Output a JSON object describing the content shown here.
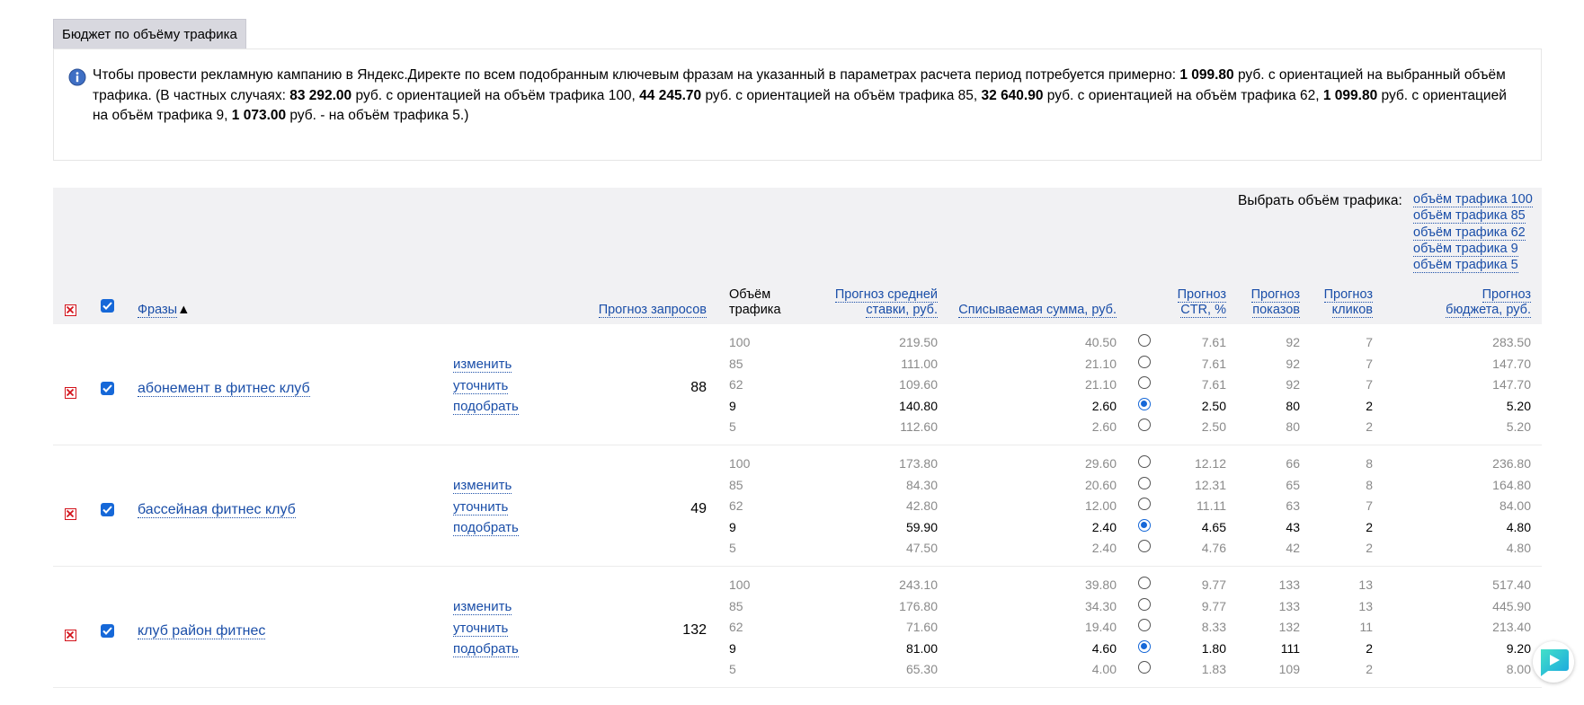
{
  "tab_title": "Бюджет по объёму трафика",
  "info": {
    "parts": [
      {
        "t": "Чтобы провести рекламную кампанию в Яндекс.Директе по всем подобранным ключевым фразам на указанный в параметрах расчета период потребуется примерно: ",
        "b": false
      },
      {
        "t": "1 099.80",
        "b": true
      },
      {
        "t": " руб. с ориентацией на выбранный объём трафика. (В частных случаях: ",
        "b": false
      },
      {
        "t": "83 292.00",
        "b": true
      },
      {
        "t": " руб. с ориентацией на объём трафика 100, ",
        "b": false
      },
      {
        "t": "44 245.70",
        "b": true
      },
      {
        "t": " руб. с ориентацией на объём трафика 85, ",
        "b": false
      },
      {
        "t": "32 640.90",
        "b": true
      },
      {
        "t": " руб. с ориентацией на объём трафика 62, ",
        "b": false
      },
      {
        "t": "1 099.80",
        "b": true
      },
      {
        "t": " руб. с ориентацией на объём трафика 9, ",
        "b": false
      },
      {
        "t": "1 073.00",
        "b": true
      },
      {
        "t": " руб. - на объём трафика 5.)",
        "b": false
      }
    ]
  },
  "traffic_select": {
    "label": "Выбрать объём трафика:",
    "options": [
      "объём трафика 100",
      "объём трафика 85",
      "объём трафика 62",
      "объём трафика 9",
      "объём трафика 5"
    ]
  },
  "columns": {
    "phrases": "Фразы",
    "phrases_sort": "▲",
    "requests": "Прогноз запросов",
    "traffic_l1": "Объём",
    "traffic_l2": "трафика",
    "bid_l1": "Прогноз средней",
    "bid_l2": "ставки, руб.",
    "charge": "Списываемая сумма, руб.",
    "ctr_l1": "Прогноз",
    "ctr_l2": "CTR, %",
    "shows_l1": "Прогноз",
    "shows_l2": "показов",
    "clicks_l1": "Прогноз",
    "clicks_l2": "кликов",
    "budget_l1": "Прогноз",
    "budget_l2": "бюджета, руб."
  },
  "actions": [
    "изменить",
    "уточнить",
    "подобрать"
  ],
  "rows": [
    {
      "phrase": "абонемент в фитнес клуб",
      "requests": "88",
      "selected": 3,
      "lines": [
        {
          "traffic": "100",
          "bid": "219.50",
          "charge": "40.50",
          "ctr": "7.61",
          "shows": "92",
          "clicks": "7",
          "budget": "283.50"
        },
        {
          "traffic": "85",
          "bid": "111.00",
          "charge": "21.10",
          "ctr": "7.61",
          "shows": "92",
          "clicks": "7",
          "budget": "147.70"
        },
        {
          "traffic": "62",
          "bid": "109.60",
          "charge": "21.10",
          "ctr": "7.61",
          "shows": "92",
          "clicks": "7",
          "budget": "147.70"
        },
        {
          "traffic": "9",
          "bid": "140.80",
          "charge": "2.60",
          "ctr": "2.50",
          "shows": "80",
          "clicks": "2",
          "budget": "5.20"
        },
        {
          "traffic": "5",
          "bid": "112.60",
          "charge": "2.60",
          "ctr": "2.50",
          "shows": "80",
          "clicks": "2",
          "budget": "5.20"
        }
      ]
    },
    {
      "phrase": "бассейная фитнес клуб",
      "requests": "49",
      "selected": 3,
      "lines": [
        {
          "traffic": "100",
          "bid": "173.80",
          "charge": "29.60",
          "ctr": "12.12",
          "shows": "66",
          "clicks": "8",
          "budget": "236.80"
        },
        {
          "traffic": "85",
          "bid": "84.30",
          "charge": "20.60",
          "ctr": "12.31",
          "shows": "65",
          "clicks": "8",
          "budget": "164.80"
        },
        {
          "traffic": "62",
          "bid": "42.80",
          "charge": "12.00",
          "ctr": "11.11",
          "shows": "63",
          "clicks": "7",
          "budget": "84.00"
        },
        {
          "traffic": "9",
          "bid": "59.90",
          "charge": "2.40",
          "ctr": "4.65",
          "shows": "43",
          "clicks": "2",
          "budget": "4.80"
        },
        {
          "traffic": "5",
          "bid": "47.50",
          "charge": "2.40",
          "ctr": "4.76",
          "shows": "42",
          "clicks": "2",
          "budget": "4.80"
        }
      ]
    },
    {
      "phrase": "клуб район фитнес",
      "requests": "132",
      "selected": 3,
      "lines": [
        {
          "traffic": "100",
          "bid": "243.10",
          "charge": "39.80",
          "ctr": "9.77",
          "shows": "133",
          "clicks": "13",
          "budget": "517.40"
        },
        {
          "traffic": "85",
          "bid": "176.80",
          "charge": "34.30",
          "ctr": "9.77",
          "shows": "133",
          "clicks": "13",
          "budget": "445.90"
        },
        {
          "traffic": "62",
          "bid": "71.60",
          "charge": "19.40",
          "ctr": "8.33",
          "shows": "132",
          "clicks": "11",
          "budget": "213.40"
        },
        {
          "traffic": "9",
          "bid": "81.00",
          "charge": "4.60",
          "ctr": "1.80",
          "shows": "111",
          "clicks": "2",
          "budget": "9.20"
        },
        {
          "traffic": "5",
          "bid": "65.30",
          "charge": "4.00",
          "ctr": "1.83",
          "shows": "109",
          "clicks": "2",
          "budget": "8.00"
        }
      ]
    }
  ],
  "colors": {
    "link": "#1a4ea8",
    "accent": "#1668d8",
    "remove": "#d3131b",
    "header_bg": "#f1f1f3"
  }
}
